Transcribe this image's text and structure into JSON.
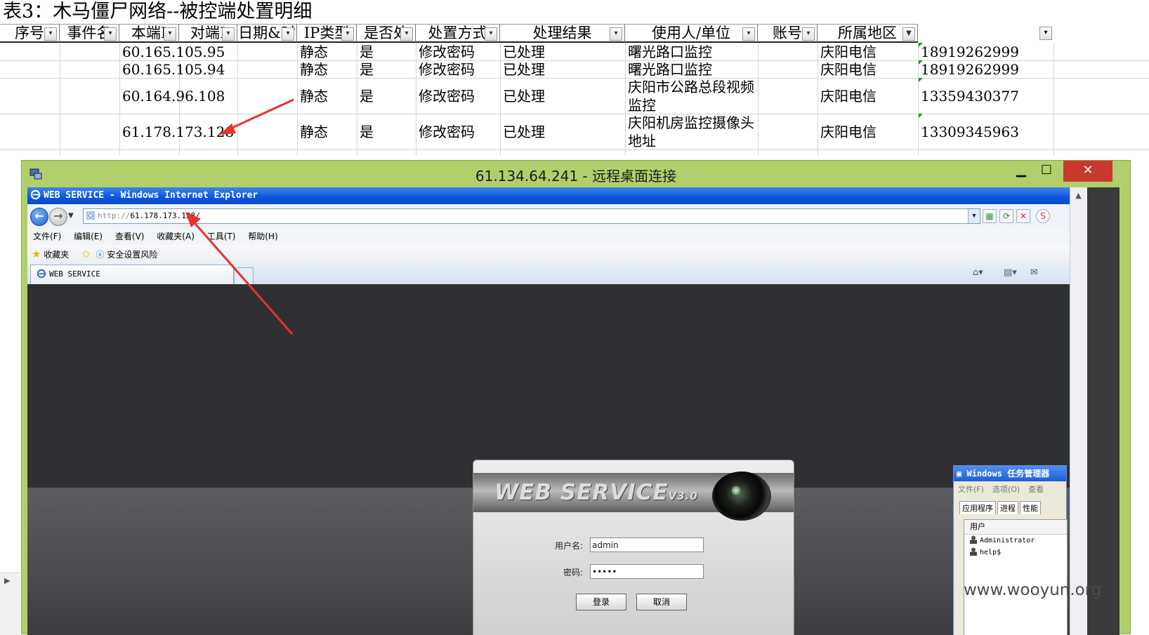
{
  "sheet": {
    "title": "表3：木马僵尸网络--被控端处置明细",
    "headers": [
      "序号",
      "事件名",
      "本端I",
      "对端I",
      "日期&时",
      "IP类型",
      "是否处",
      "处置方式",
      "处理结果",
      "使用人/单位",
      "账号",
      "所属地区"
    ],
    "rows": [
      {
        "local_ip": "60.165.105.95",
        "ip_type": "静态",
        "handled": "是",
        "method": "修改密码",
        "result": "已处理",
        "user": "曙光路口监控",
        "region": "庆阳电信",
        "phone": "18919262999"
      },
      {
        "local_ip": "60.165.105.94",
        "ip_type": "静态",
        "handled": "是",
        "method": "修改密码",
        "result": "已处理",
        "user": "曙光路口监控",
        "region": "庆阳电信",
        "phone": "18919262999"
      },
      {
        "local_ip": "60.164.96.108",
        "ip_type": "静态",
        "handled": "是",
        "method": "修改密码",
        "result": "已处理",
        "user": "庆阳市公路总段视频监控",
        "region": "庆阳电信",
        "phone": "13359430377"
      },
      {
        "local_ip": "61.178.173.128",
        "ip_type": "静态",
        "handled": "是",
        "method": "修改密码",
        "result": "已处理",
        "user": "庆阳机房监控摄像头地址",
        "region": "庆阳电信",
        "phone": "13309345963"
      }
    ]
  },
  "rdp": {
    "title": "61.134.64.241 - 远程桌面连接",
    "min_icon": "minimize-icon",
    "max_icon": "maximize-icon",
    "close_icon": "close-icon"
  },
  "ie": {
    "title": "WEB SERVICE - Windows Internet Explorer",
    "url_scheme": "http://",
    "url_host": "61.178.173.128/",
    "menu": [
      "文件(F)",
      "编辑(E)",
      "查看(V)",
      "收藏夹(A)",
      "工具(T)",
      "帮助(H)"
    ],
    "favorites": "收藏夹",
    "fav_link": "安全设置风险",
    "tab_label": "WEB SERVICE"
  },
  "login": {
    "brand": "WEB  SERVICE",
    "version": "V3.0",
    "user_label": "用户名:",
    "user_value": "admin",
    "pass_label": "密码:",
    "pass_value": "•••••",
    "login_button": "登录",
    "cancel_button": "取消"
  },
  "taskmgr": {
    "title": "Windows 任务管理器",
    "menu": [
      "文件(F)",
      "选项(O)",
      "查看"
    ],
    "tabs": [
      "应用程序",
      "进程",
      "性能"
    ],
    "column": "用户",
    "users": [
      "Administrator",
      "help$"
    ]
  },
  "watermark": "www.wooyun.org",
  "colors": {
    "rdp_frame": "#b2cf6c",
    "ie_title": "#0c55dc",
    "close_red": "#c7392c",
    "arrow": "#e8322b"
  }
}
